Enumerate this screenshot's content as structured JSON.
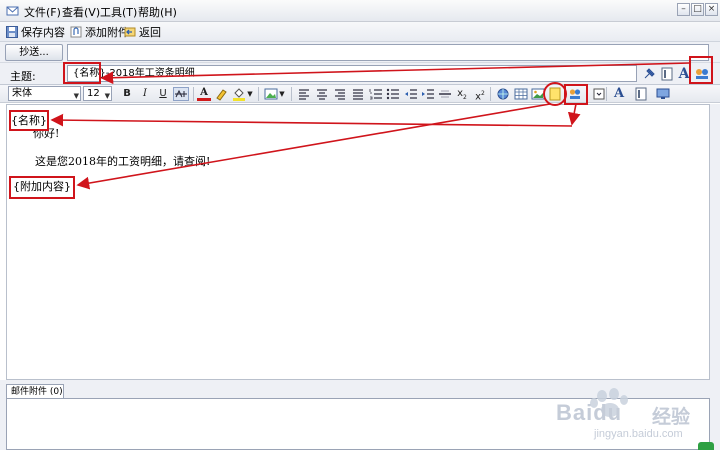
{
  "menubar": {
    "items": [
      {
        "id": "file",
        "label": "文件(F)"
      },
      {
        "id": "view",
        "label": "查看(V)"
      },
      {
        "id": "tools",
        "label": "工具(T)"
      },
      {
        "id": "help",
        "label": "帮助(H)"
      }
    ]
  },
  "toolbar": {
    "save_label": "保存内容",
    "attach_label": "添加附件",
    "back_label": "返回"
  },
  "header": {
    "cc_label": "抄送...",
    "cc_value": "",
    "subject_label": "主题:",
    "subject_value": "{名称}-2018年工资条明细"
  },
  "format": {
    "font_name": "宋体",
    "font_size": "12"
  },
  "body": {
    "greeting": "你好!",
    "message": "这是您2018年的工资明细，请查阅!"
  },
  "annotations": {
    "name_tag": "{名称}",
    "extra_tag": "{附加内容}"
  },
  "attachments": {
    "tab_label": "邮件附件 (0)"
  },
  "watermark": {
    "brand": "Baidu",
    "brand_cn": "经验",
    "url": "jingyan.baidu.com"
  },
  "colors": {
    "annotation_red": "#d0141b",
    "toolbar_bg": "#e9ecf2",
    "panel_bg": "#eef0f5"
  }
}
